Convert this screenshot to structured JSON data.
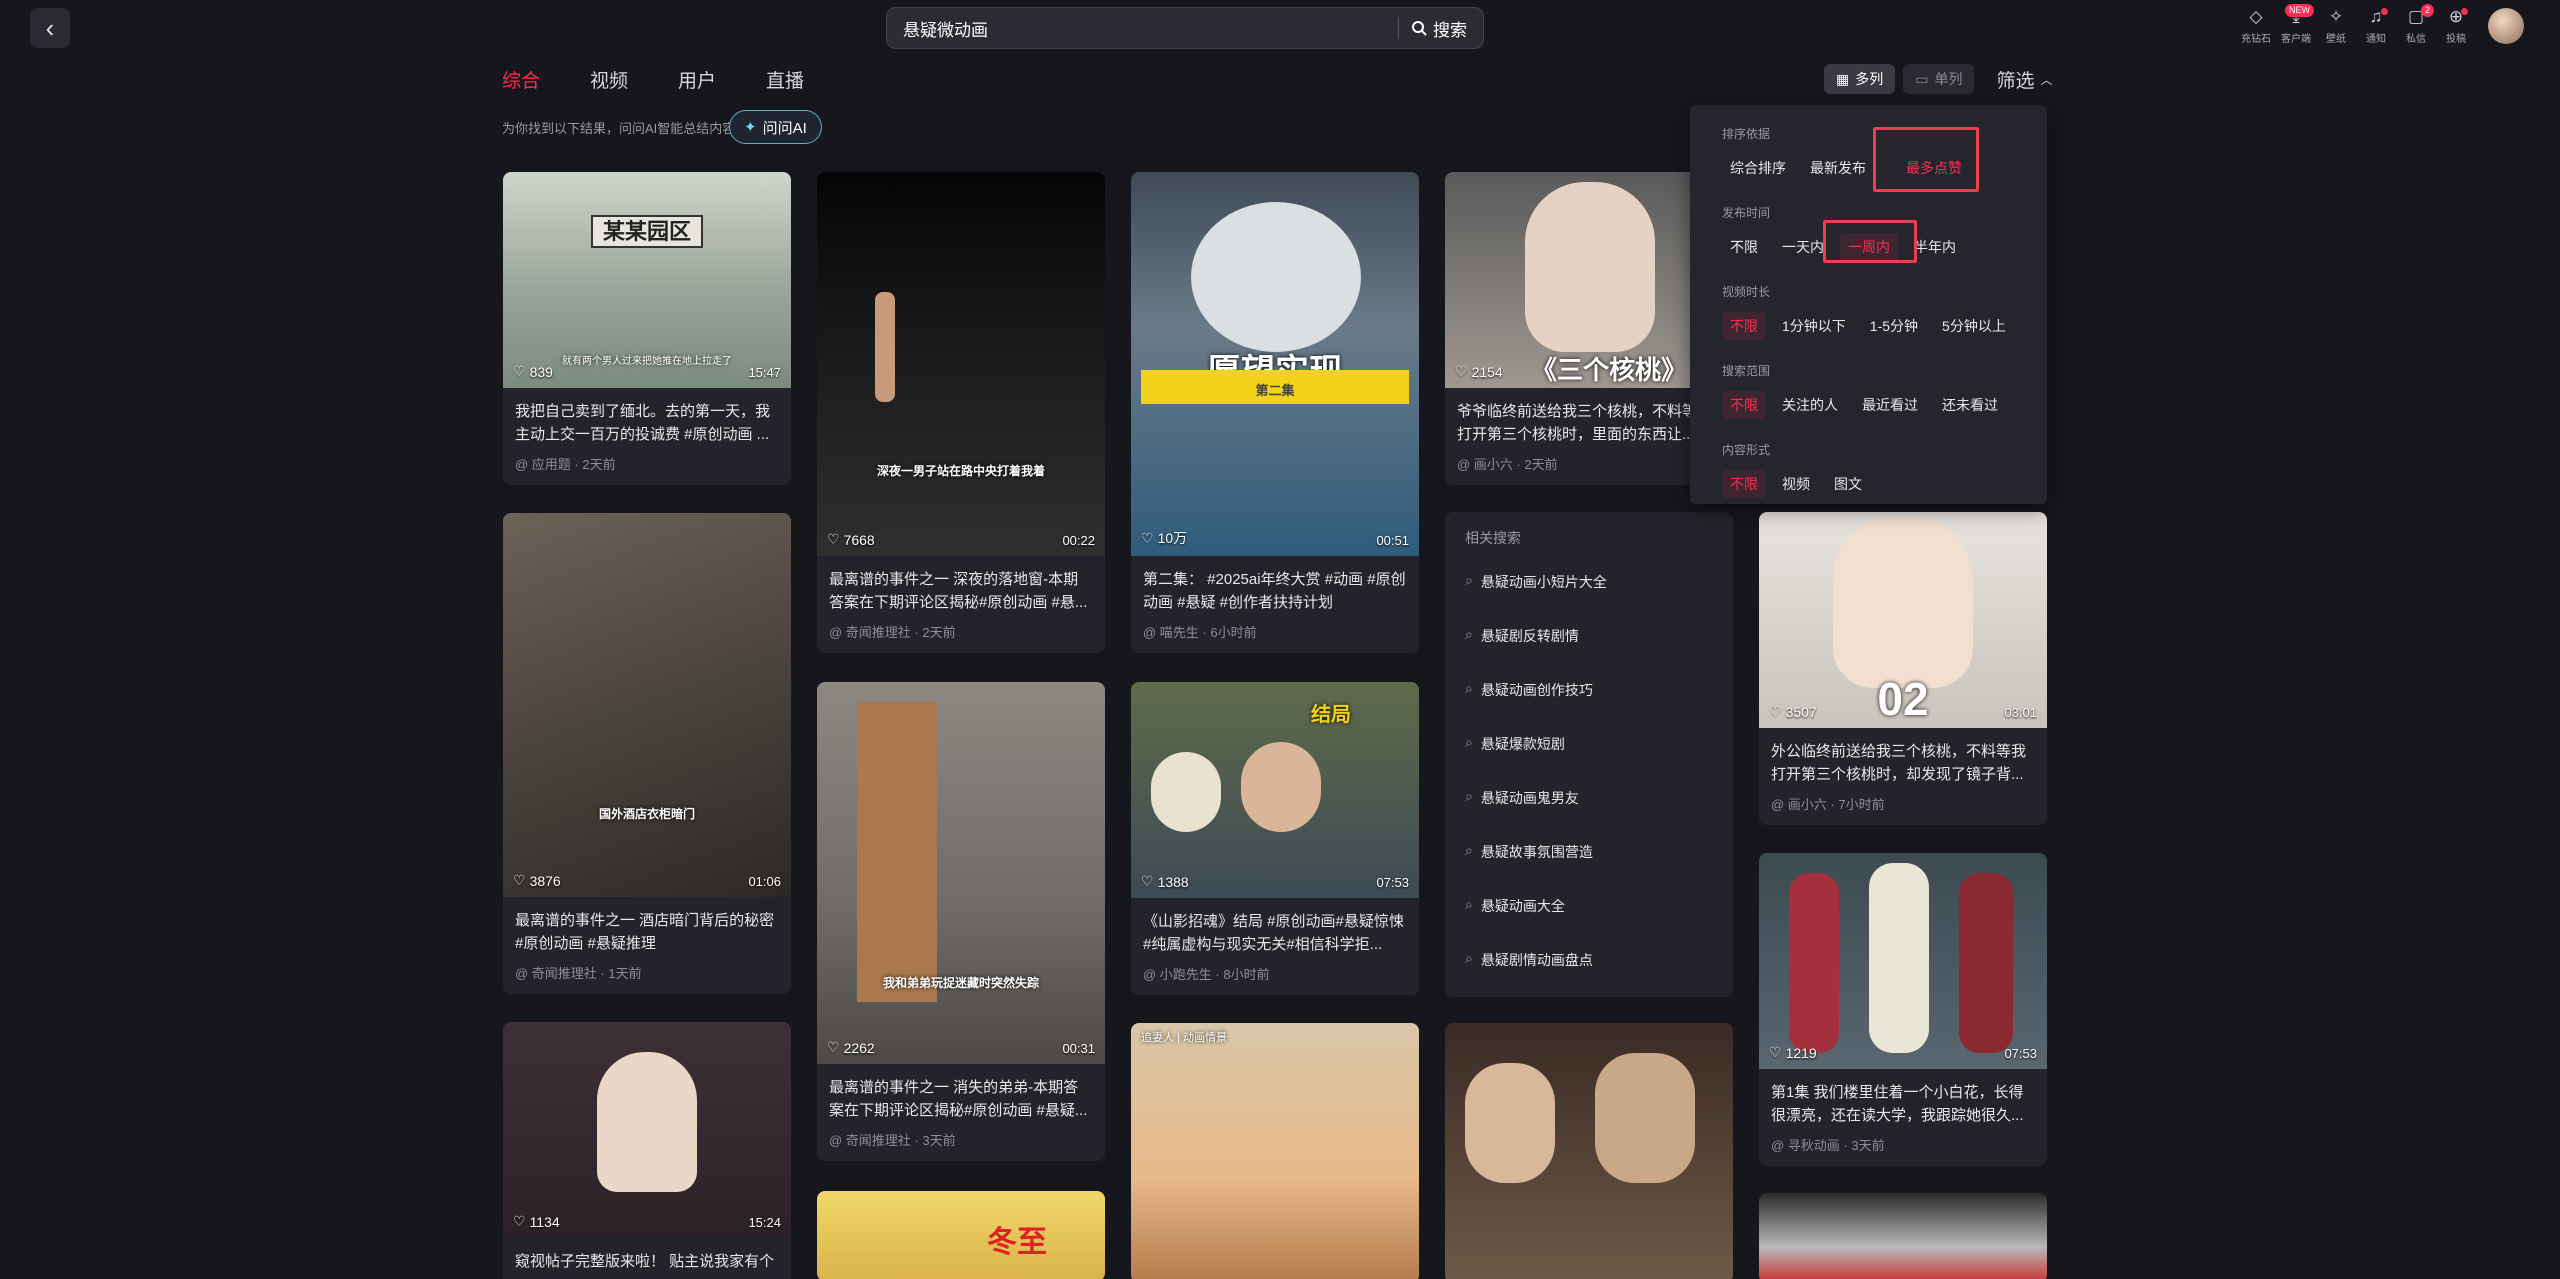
{
  "header": {
    "search_value": "悬疑微动画",
    "search_button": "搜索",
    "icons": [
      {
        "icon": "diamond-icon",
        "label": "充钻石"
      },
      {
        "icon": "download-icon",
        "label": "客户端",
        "badge": "NEW"
      },
      {
        "icon": "wallpaper-icon",
        "label": "壁纸"
      },
      {
        "icon": "bell-icon",
        "label": "通知",
        "dot": true
      },
      {
        "icon": "message-icon",
        "label": "私信",
        "badge": "2"
      },
      {
        "icon": "upload-icon",
        "label": "投稿",
        "dot": true
      }
    ]
  },
  "tabs": [
    "综合",
    "视频",
    "用户",
    "直播"
  ],
  "view_toggle": {
    "multi": "多列",
    "single": "单列",
    "filter": "筛选"
  },
  "ai": {
    "hint": "为你找到以下结果，问问AI智能总结内容",
    "button": "问问AI"
  },
  "cards": [
    {
      "id": "c1",
      "likes": "839",
      "duration": "15:47",
      "title": "我把自己卖到了缅北。去的第一天，我主动上交一百万的投诚费 #原创动画 ...",
      "meta": "@ 应用题 · 2天前",
      "caption": "某某园区",
      "subcap": "就有两个男人过来把她推在地上拉走了"
    },
    {
      "id": "c2",
      "likes": "7668",
      "duration": "00:22",
      "title": "最离谱的事件之一 深夜的落地窗-本期答案在下期评论区揭秘#原创动画 #悬...",
      "meta": "@ 奇闻推理社 · 2天前",
      "caption": "深夜一男子站在路中央打着我着"
    },
    {
      "id": "c3",
      "likes": "10万",
      "duration": "00:51",
      "title": "第二集： #2025ai年终大赏 #动画 #原创动画 #悬疑 #创作者扶持计划",
      "meta": "@ 喵先生 · 6小时前",
      "caption": "愿望实现",
      "subcap": "第二集"
    },
    {
      "id": "c4",
      "likes": "2154",
      "duration": "",
      "title": "爷爷临终前送给我三个核桃，不料等我打开第三个核桃时，里面的东西让...",
      "meta": "@ 画小六 · 2天前",
      "caption": "《三个核桃》"
    },
    {
      "id": "c5",
      "likes": "3876",
      "duration": "01:06",
      "title": "最离谱的事件之一 酒店暗门背后的秘密 #原创动画 #悬疑推理",
      "meta": "@ 奇闻推理社 · 1天前",
      "caption": "国外酒店衣柜暗门"
    },
    {
      "id": "c6",
      "likes": "2262",
      "duration": "00:31",
      "title": "最离谱的事件之一 消失的弟弟-本期答案在下期评论区揭秘#原创动画 #悬疑...",
      "meta": "@ 奇闻推理社 · 3天前",
      "caption": "我和弟弟玩捉迷藏时突然失踪"
    },
    {
      "id": "c7",
      "likes": "1388",
      "duration": "07:53",
      "title": "《山影招魂》结局 #原创动画#悬疑惊悚#纯属虚构与现实无关#相信科学拒...",
      "meta": "@ 小跑先生 · 8小时前",
      "caption": "结局"
    },
    {
      "id": "c8",
      "likes": "3507",
      "duration": "03:01",
      "title": "外公临终前送给我三个核桃，不料等我打开第三个核桃时，却发现了镜子背...",
      "meta": "@ 画小六 · 7小时前",
      "caption": "02"
    },
    {
      "id": "c9",
      "likes": "1134",
      "duration": "15:24",
      "title": "窥视帖子完整版来啦！ 贴主说我家有个",
      "meta": ""
    },
    {
      "id": "c10",
      "likes": "1219",
      "duration": "07:53",
      "title": "第1集 我们楼里住着一个小白花，长得很漂亮，还在读大学，我跟踪她很久...",
      "meta": "@ 寻秋动画 · 3天前"
    },
    {
      "id": "c11",
      "likes": "",
      "duration": "",
      "title": "",
      "meta": "",
      "caption": "冬至"
    },
    {
      "id": "c12",
      "likes": "",
      "duration": "",
      "title": "",
      "meta": "",
      "caption": "追妻人 | 动画情景"
    }
  ],
  "related": {
    "title": "相关搜索",
    "items": [
      "悬疑动画小短片大全",
      "悬疑剧反转剧情",
      "悬疑动画创作技巧",
      "悬疑爆款短剧",
      "悬疑动画鬼男友",
      "悬疑故事氛围营造",
      "悬疑动画大全",
      "悬疑剧情动画盘点"
    ]
  },
  "filter_panel": {
    "groups": [
      {
        "label": "排序依据",
        "options": [
          "综合排序",
          "最新发布",
          "最多点赞"
        ],
        "selected": 2
      },
      {
        "label": "发布时间",
        "options": [
          "不限",
          "一天内",
          "一周内",
          "半年内"
        ],
        "selected": 2
      },
      {
        "label": "视频时长",
        "options": [
          "不限",
          "1分钟以下",
          "1-5分钟",
          "5分钟以上"
        ],
        "selected": 0
      },
      {
        "label": "搜索范围",
        "options": [
          "不限",
          "关注的人",
          "最近看过",
          "还未看过"
        ],
        "selected": 0
      },
      {
        "label": "内容形式",
        "options": [
          "不限",
          "视频",
          "图文"
        ],
        "selected": 0
      }
    ]
  },
  "colors": {
    "accent": "#fe2c55",
    "bg": "#16161d",
    "card": "#23232c",
    "highlight_box": "#e8404e"
  }
}
